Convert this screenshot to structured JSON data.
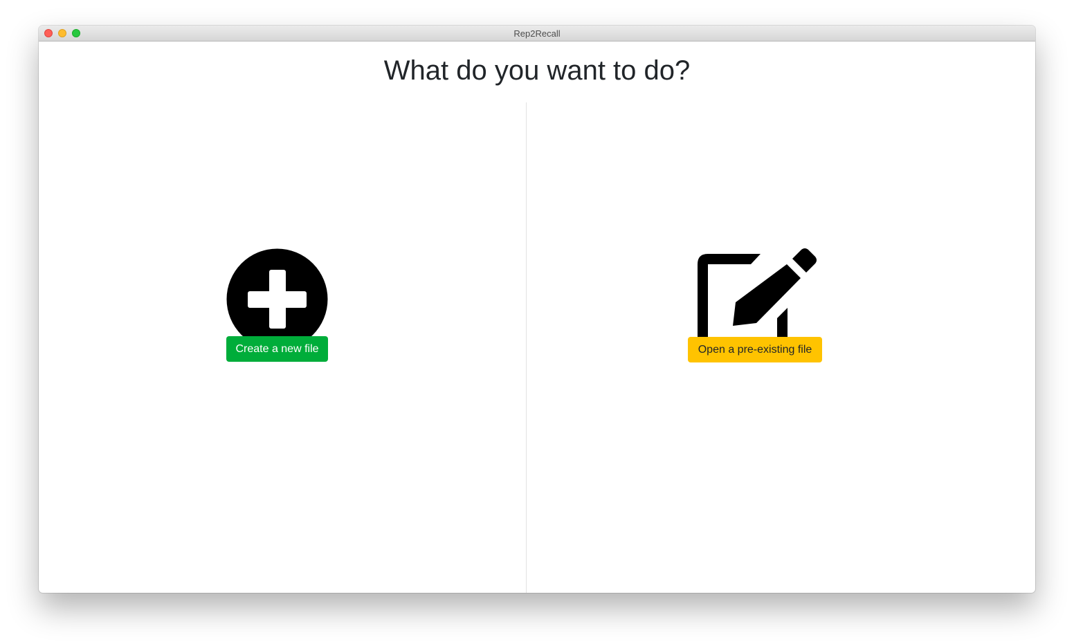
{
  "window": {
    "title": "Rep2Recall"
  },
  "main": {
    "heading": "What do you want to do?",
    "create": {
      "icon": "plus-circle-icon",
      "button_label": "Create a new file",
      "button_color": "#00ad3a"
    },
    "open": {
      "icon": "edit-icon",
      "button_label": "Open a pre-existing file",
      "button_color": "#ffc300"
    }
  }
}
